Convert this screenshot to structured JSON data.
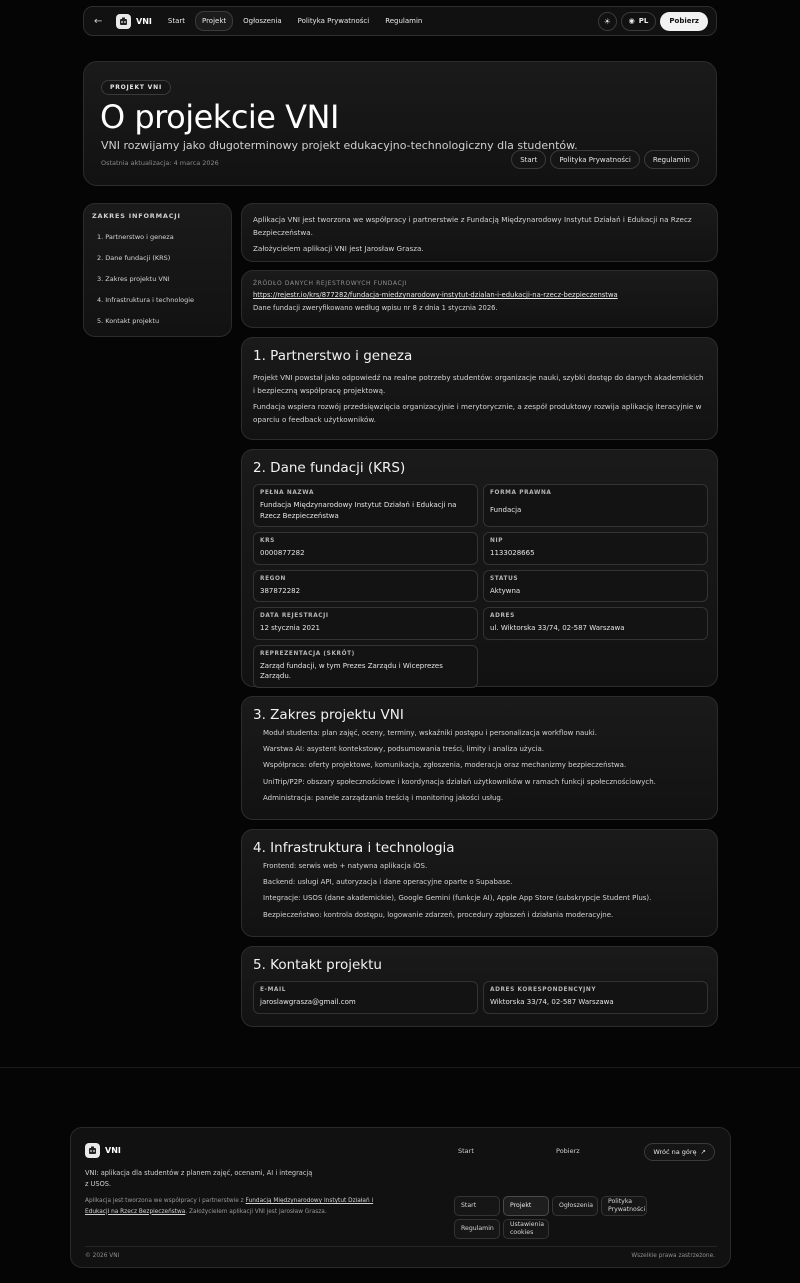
{
  "nav": {
    "back_icon": "arrow-left-icon",
    "brand": "VNI",
    "links": [
      "Start",
      "Projekt",
      "Ogłoszenia",
      "Polityka Prywatności",
      "Regulamin"
    ],
    "active_link": "Projekt",
    "theme_icon": "sun-icon",
    "lang_icon": "globe-icon",
    "lang": "PL",
    "download": "Pobierz"
  },
  "hero": {
    "badge": "PROJEKT VNI",
    "title": "O projekcie VNI",
    "subtitle": "VNI rozwijamy jako długoterminowy projekt edukacyjno-technologiczny dla studentów.",
    "updated": "Ostatnia aktualizacja: 4 marca 2026",
    "links": [
      "Start",
      "Polityka Prywatności",
      "Regulamin"
    ]
  },
  "sidebar": {
    "title": "ZAKRES INFORMACJI",
    "items": [
      "1. Partnerstwo i geneza",
      "2. Dane fundacji (KRS)",
      "3. Zakres projektu VNI",
      "4. Infrastruktura i technologie",
      "5. Kontakt projektu"
    ]
  },
  "intro": {
    "p1": "Aplikacja VNI jest tworzona we współpracy i partnerstwie z Fundacją Międzynarodowy Instytut Działań i Edukacji na Rzecz Bezpieczeństwa.",
    "p2": "Założycielem aplikacji VNI jest Jarosław Grasza."
  },
  "source": {
    "label": "ŹRÓDŁO DANYCH REJESTROWYCH FUNDACJI",
    "url": "https://rejestr.io/krs/877282/fundacja-miedzynarodowy-instytut-dzialan-i-edukacji-na-rzecz-bezpieczenstwa",
    "note": "Dane fundacji zweryfikowano według wpisu nr 8 z dnia 1 stycznia 2026."
  },
  "s1": {
    "title": "1. Partnerstwo i geneza",
    "p1": "Projekt VNI powstał jako odpowiedź na realne potrzeby studentów: organizacje nauki, szybki dostęp do danych akademickich i bezpieczną współpracę projektową.",
    "p2": "Fundacja wspiera rozwój przedsięwzięcia organizacyjnie i merytorycznie, a zespół produktowy rozwija aplikację iteracyjnie w oparciu o feedback użytkowników."
  },
  "s2": {
    "title": "2. Dane fundacji (KRS)",
    "fields": [
      {
        "label": "PEŁNA NAZWA",
        "value": "Fundacja Międzynarodowy Instytut Działań i Edukacji na Rzecz Bezpieczeństwa"
      },
      {
        "label": "FORMA PRAWNA",
        "value": "Fundacja"
      },
      {
        "label": "KRS",
        "value": "0000877282"
      },
      {
        "label": "NIP",
        "value": "1133028665"
      },
      {
        "label": "REGON",
        "value": "387872282"
      },
      {
        "label": "STATUS",
        "value": "Aktywna"
      },
      {
        "label": "DATA REJESTRACJI",
        "value": "12 stycznia 2021"
      },
      {
        "label": "ADRES",
        "value": "ul. Wiktorska 33/74, 02-587 Warszawa"
      },
      {
        "label": "REPREZENTACJA (SKRÓT)",
        "value": "Zarząd fundacji, w tym Prezes Zarządu i Wiceprezes Zarządu."
      }
    ]
  },
  "s3": {
    "title": "3. Zakres projektu VNI",
    "items": [
      "Moduł studenta: plan zajęć, oceny, terminy, wskaźniki postępu i personalizacja workflow nauki.",
      "Warstwa AI: asystent kontekstowy, podsumowania treści, limity i analiza użycia.",
      "Współpraca: oferty projektowe, komunikacja, zgłoszenia, moderacja oraz mechanizmy bezpieczeństwa.",
      "UniTrip/P2P: obszary społecznościowe i koordynacja działań użytkowników w ramach funkcji społecznościowych.",
      "Administracja: panele zarządzania treścią i monitoring jakości usług."
    ]
  },
  "s4": {
    "title": "4. Infrastruktura i technologia",
    "items": [
      "Frontend: serwis web + natywna aplikacja iOS.",
      "Backend: usługi API, autoryzacja i dane operacyjne oparte o Supabase.",
      "Integracje: USOS (dane akademickie), Google Gemini (funkcje AI), Apple App Store (subskrypcje Student Plus).",
      "Bezpieczeństwo: kontrola dostępu, logowanie zdarzeń, procedury zgłoszeń i działania moderacyjne."
    ]
  },
  "s5": {
    "title": "5. Kontakt projektu",
    "fields": [
      {
        "label": "E-MAIL",
        "value": "jaroslawgrasza@gmail.com"
      },
      {
        "label": "ADRES KORESPONDENCYJNY",
        "value": "Wiktorska 33/74, 02-587 Warszawa"
      }
    ]
  },
  "footer": {
    "brand": "VNI",
    "desc": "VNI: aplikacja dla studentów z planem zajęć, ocenami, AI i integracją z USOS.",
    "note_pre": "Aplikacja jest tworzona we współpracy i partnerstwie z ",
    "note_link": "Fundacją Międzynarodowy Instytut Działań i Edukacji na Rzecz Bezpieczeństwa",
    "note_post": ". Założycielem aplikacji VNI jest Jarosław Grasza.",
    "top_links": [
      "Start",
      "Pobierz"
    ],
    "to_top": "Wróć na górę",
    "to_top_icon": "arrow-up-right-icon",
    "buttons": [
      "Start",
      "Projekt",
      "Ogłoszenia",
      "Polityka Prywatności",
      "Regulamin",
      "Ustawienia cookies"
    ],
    "copyright": "© 2026 VNI",
    "rights": "Wszelkie prawa zastrzeżone."
  }
}
